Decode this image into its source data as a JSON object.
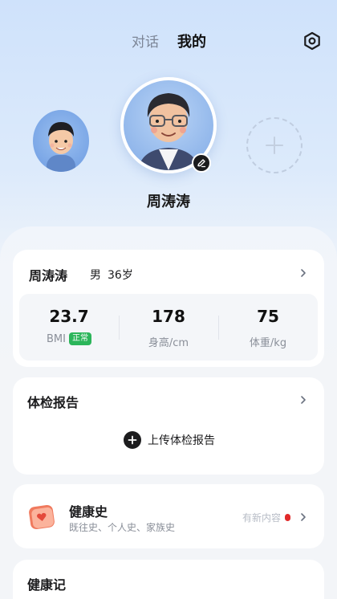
{
  "header": {
    "tabs": [
      {
        "label": "对话",
        "active": false
      },
      {
        "label": "我的",
        "active": true
      }
    ],
    "settings_icon": "settings-hexagon-icon"
  },
  "profiles": {
    "current_name": "周涛涛",
    "add_icon": "plus-icon",
    "edit_icon": "pencil-edit-icon"
  },
  "info_card": {
    "name": "周涛涛",
    "gender": "男",
    "age": "36岁",
    "stats": [
      {
        "value": "23.7",
        "label": "BMI",
        "badge": "正常"
      },
      {
        "value": "178",
        "label": "身高/cm"
      },
      {
        "value": "75",
        "label": "体重/kg"
      }
    ]
  },
  "report_card": {
    "title": "体检报告",
    "upload_label": "上传体检报告"
  },
  "history_card": {
    "title": "健康史",
    "subtitle": "既往史、个人史、家族史",
    "status": "有新内容",
    "icon": "calendar-heart-icon"
  },
  "notes_card": {
    "title": "健康记"
  },
  "colors": {
    "accent_green": "#2bb55a",
    "notification_red": "#e12a2a",
    "background_top": "#cfe2fb"
  }
}
